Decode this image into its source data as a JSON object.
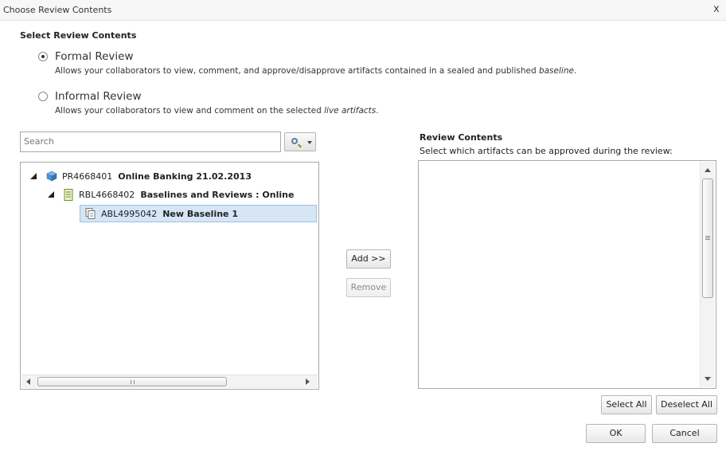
{
  "dialog": {
    "title": "Choose Review Contents",
    "close_label": "x"
  },
  "select_section": {
    "title": "Select Review Contents",
    "options": [
      {
        "label": "Formal Review",
        "selected": true,
        "description_prefix": "Allows your collaborators to view, comment, and approve/disapprove artifacts contained in a sealed and published ",
        "description_emphasis": "baseline",
        "description_suffix": "."
      },
      {
        "label": "Informal Review",
        "selected": false,
        "description_prefix": "Allows your collaborators to view and comment on the selected ",
        "description_emphasis": "live artifacts",
        "description_suffix": "."
      }
    ]
  },
  "search": {
    "placeholder": "Search",
    "button_icon": "search-icon"
  },
  "tree": {
    "nodes": [
      {
        "id": "PR4668401",
        "name": "Online Banking 21.02.2013",
        "icon": "project-cube-icon",
        "expanded": true
      },
      {
        "id": "RBL4668402",
        "name": "Baselines and Reviews : Online",
        "icon": "baseline-library-icon",
        "expanded": true
      },
      {
        "id": "ABL4995042",
        "name": "New Baseline 1",
        "icon": "baseline-icon",
        "selected": true
      }
    ]
  },
  "middle_buttons": {
    "add": "Add >>",
    "remove": "Remove"
  },
  "review_contents": {
    "title": "Review Contents",
    "subtitle": "Select which artifacts can be approved during the review:"
  },
  "bottom_buttons": {
    "select_all": "Select All",
    "deselect_all": "Deselect All",
    "ok": "OK",
    "cancel": "Cancel"
  }
}
